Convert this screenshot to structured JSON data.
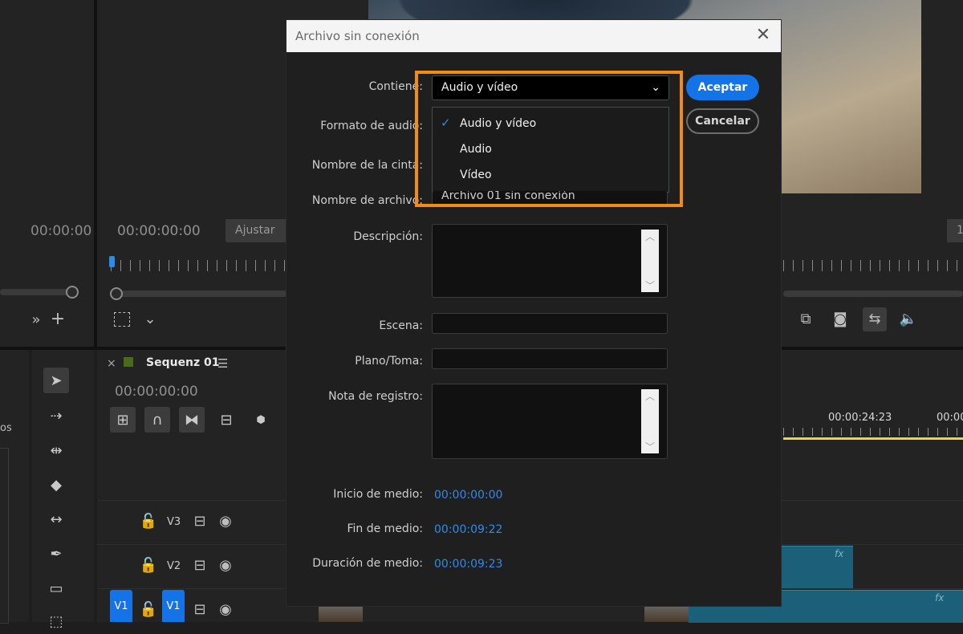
{
  "background": {
    "source_timecode_left": "00:00:00",
    "program_timecode": "00:00:00:00",
    "fit_label": "Ajustar",
    "right_edge_fragment": "1",
    "timeline": {
      "close_symbol": "×",
      "sequence_name": "Sequenz 01",
      "timecode": "00:00:00:00",
      "ruler_time_1": "00:00:24:23",
      "ruler_time_2": "00:00",
      "left_fragment": "os",
      "tracks": [
        {
          "name": "V3"
        },
        {
          "name": "V2"
        },
        {
          "name": "V1",
          "source": "V1"
        }
      ],
      "fx_label": "fx"
    }
  },
  "dialog": {
    "title": "Archivo sin conexión",
    "close_symbol": "✕",
    "labels": {
      "contains": "Contiene:",
      "audio_format": "Formato de audio:",
      "tape_name": "Nombre de la cinta:",
      "file_name": "Nombre de archivo:",
      "description": "Descripción:",
      "scene": "Escena:",
      "shot": "Plano/Toma:",
      "log_note": "Nota de registro:",
      "media_start": "Inicio de medio:",
      "media_end": "Fin de medio:",
      "media_duration": "Duración de medio:"
    },
    "contains_selected": "Audio y vídeo",
    "dropdown_options": [
      "Audio y vídeo",
      "Audio",
      "Vídeo"
    ],
    "file_name_value": "Archivo 01 sin conexión",
    "media_start_value": "00:00:00:00",
    "media_end_value": "00:00:09:22",
    "media_duration_value": "00:00:09:23",
    "accept_label": "Aceptar",
    "cancel_label": "Cancelar"
  },
  "colors": {
    "accent": "#1473e6",
    "highlight": "#f28c16",
    "timecode_blue": "#2d8ceb",
    "clip": "#1b5f78"
  }
}
